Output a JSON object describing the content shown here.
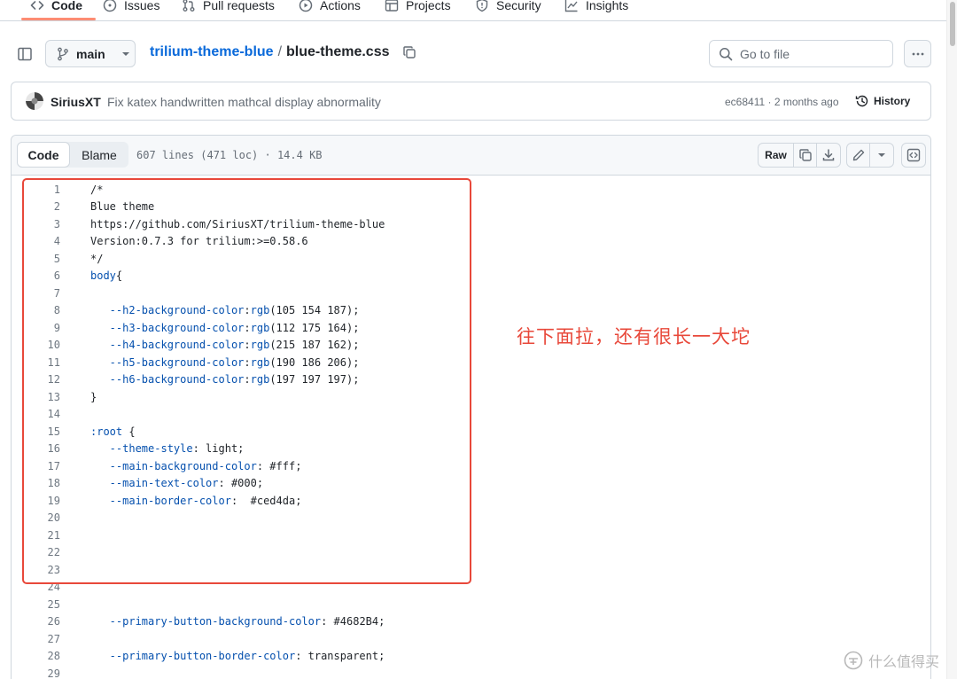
{
  "nav": {
    "tabs": [
      {
        "label": "Code",
        "icon": "code-icon",
        "active": true
      },
      {
        "label": "Issues",
        "icon": "issue-opened-icon"
      },
      {
        "label": "Pull requests",
        "icon": "git-pull-request-icon"
      },
      {
        "label": "Actions",
        "icon": "play-icon"
      },
      {
        "label": "Projects",
        "icon": "table-icon"
      },
      {
        "label": "Security",
        "icon": "shield-icon"
      },
      {
        "label": "Insights",
        "icon": "graph-icon"
      }
    ]
  },
  "file_header": {
    "branch": "main",
    "repo": "trilium-theme-blue",
    "separator": "/",
    "file": "blue-theme.css",
    "goto_placeholder": "Go to file"
  },
  "commit": {
    "author": "SiriusXT",
    "message": "Fix katex handwritten mathcal display abnormality",
    "meta": "ec68411 · 2 months ago",
    "history_label": "History"
  },
  "code_toolbar": {
    "code_tab": "Code",
    "blame_tab": "Blame",
    "file_info": "607 lines (471 loc) · 14.4 KB",
    "raw_label": "Raw"
  },
  "code_lines": [
    {
      "n": "1",
      "tokens": [
        {
          "t": "/*",
          "c": "com"
        }
      ]
    },
    {
      "n": "2",
      "tokens": [
        {
          "t": "Blue theme",
          "c": "com"
        }
      ]
    },
    {
      "n": "3",
      "tokens": [
        {
          "t": "https://github.com/SiriusXT/trilium-theme-blue",
          "c": "com"
        }
      ]
    },
    {
      "n": "4",
      "tokens": [
        {
          "t": "Version:0.7.3 for trilium:>=0.58.6",
          "c": "com"
        }
      ]
    },
    {
      "n": "5",
      "tokens": [
        {
          "t": "*/",
          "c": "com"
        }
      ]
    },
    {
      "n": "6",
      "tokens": [
        {
          "t": "body",
          "c": "sel"
        },
        {
          "t": "{",
          "c": "txt"
        }
      ]
    },
    {
      "n": "7",
      "tokens": []
    },
    {
      "n": "8",
      "tokens": [
        {
          "t": "   --h2-background-color",
          "c": "prop"
        },
        {
          "t": ":",
          "c": "txt"
        },
        {
          "t": "rgb",
          "c": "prop"
        },
        {
          "t": "(105 154 187);",
          "c": "txt"
        }
      ]
    },
    {
      "n": "9",
      "tokens": [
        {
          "t": "   --h3-background-color",
          "c": "prop"
        },
        {
          "t": ":",
          "c": "txt"
        },
        {
          "t": "rgb",
          "c": "prop"
        },
        {
          "t": "(112 175 164);",
          "c": "txt"
        }
      ]
    },
    {
      "n": "10",
      "tokens": [
        {
          "t": "   --h4-background-color",
          "c": "prop"
        },
        {
          "t": ":",
          "c": "txt"
        },
        {
          "t": "rgb",
          "c": "prop"
        },
        {
          "t": "(215 187 162);",
          "c": "txt"
        }
      ]
    },
    {
      "n": "11",
      "tokens": [
        {
          "t": "   --h5-background-color",
          "c": "prop"
        },
        {
          "t": ":",
          "c": "txt"
        },
        {
          "t": "rgb",
          "c": "prop"
        },
        {
          "t": "(190 186 206);",
          "c": "txt"
        }
      ]
    },
    {
      "n": "12",
      "tokens": [
        {
          "t": "   --h6-background-color",
          "c": "prop"
        },
        {
          "t": ":",
          "c": "txt"
        },
        {
          "t": "rgb",
          "c": "prop"
        },
        {
          "t": "(197 197 197);",
          "c": "txt"
        }
      ]
    },
    {
      "n": "13",
      "tokens": [
        {
          "t": "}",
          "c": "txt"
        }
      ]
    },
    {
      "n": "14",
      "tokens": []
    },
    {
      "n": "15",
      "tokens": [
        {
          "t": ":root",
          "c": "sel"
        },
        {
          "t": " {",
          "c": "txt"
        }
      ]
    },
    {
      "n": "16",
      "tokens": [
        {
          "t": "   --theme-style",
          "c": "prop"
        },
        {
          "t": ": light;",
          "c": "txt"
        }
      ]
    },
    {
      "n": "17",
      "tokens": [
        {
          "t": "   --main-background-color",
          "c": "prop"
        },
        {
          "t": ": #fff;",
          "c": "txt"
        }
      ]
    },
    {
      "n": "18",
      "tokens": [
        {
          "t": "   --main-text-color",
          "c": "prop"
        },
        {
          "t": ": #000;",
          "c": "txt"
        }
      ]
    },
    {
      "n": "19",
      "tokens": [
        {
          "t": "   --main-border-color",
          "c": "prop"
        },
        {
          "t": ":  #ced4da;",
          "c": "txt"
        }
      ]
    },
    {
      "n": "20",
      "tokens": []
    },
    {
      "n": "21",
      "tokens": []
    },
    {
      "n": "22",
      "tokens": []
    },
    {
      "n": "23",
      "tokens": []
    },
    {
      "n": "24",
      "tokens": []
    },
    {
      "n": "25",
      "tokens": []
    },
    {
      "n": "26",
      "tokens": [
        {
          "t": "   --primary-button-background-color",
          "c": "prop"
        },
        {
          "t": ": #4682B4;",
          "c": "txt"
        }
      ]
    },
    {
      "n": "27",
      "tokens": []
    },
    {
      "n": "28",
      "tokens": [
        {
          "t": "   --primary-button-border-color",
          "c": "prop"
        },
        {
          "t": ": transparent;",
          "c": "txt"
        }
      ]
    },
    {
      "n": "29",
      "tokens": []
    }
  ],
  "annotation": {
    "note": "往下面拉，还有很长一大坨",
    "color": "#e8483a"
  },
  "watermark": {
    "text": "什么值得买"
  }
}
